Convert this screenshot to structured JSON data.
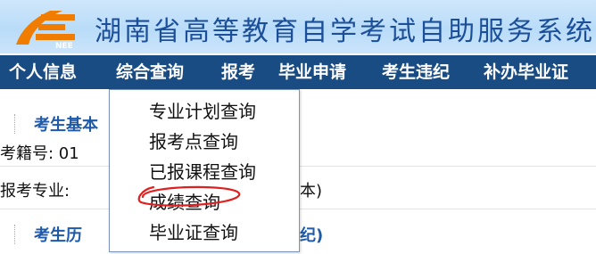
{
  "header": {
    "title": "湖南省高等教育自学考试自助服务系统",
    "logo_text": "NEE"
  },
  "nav": [
    {
      "label": "个人信息"
    },
    {
      "label": "综合查询"
    },
    {
      "label": "报考"
    },
    {
      "label": "毕业申请"
    },
    {
      "label": "考生违纪"
    },
    {
      "label": "补办毕业证"
    }
  ],
  "content": {
    "section1_title": "考生基本",
    "exam_no_label": "考籍号: 01",
    "major_label": "报考专业:",
    "major_suffix": "本)",
    "section2_title": "考生历",
    "section2_suffix": "纪)"
  },
  "dropdown": {
    "items": [
      {
        "label": "专业计划查询"
      },
      {
        "label": "报考点查询"
      },
      {
        "label": "已报课程查询"
      },
      {
        "label": "成绩查询"
      },
      {
        "label": "毕业证查询"
      }
    ]
  },
  "colors": {
    "nav_bg": "#1a4c84",
    "title": "#1c4f9a",
    "section_title": "#1f5aa8",
    "annotation": "#e02020"
  }
}
